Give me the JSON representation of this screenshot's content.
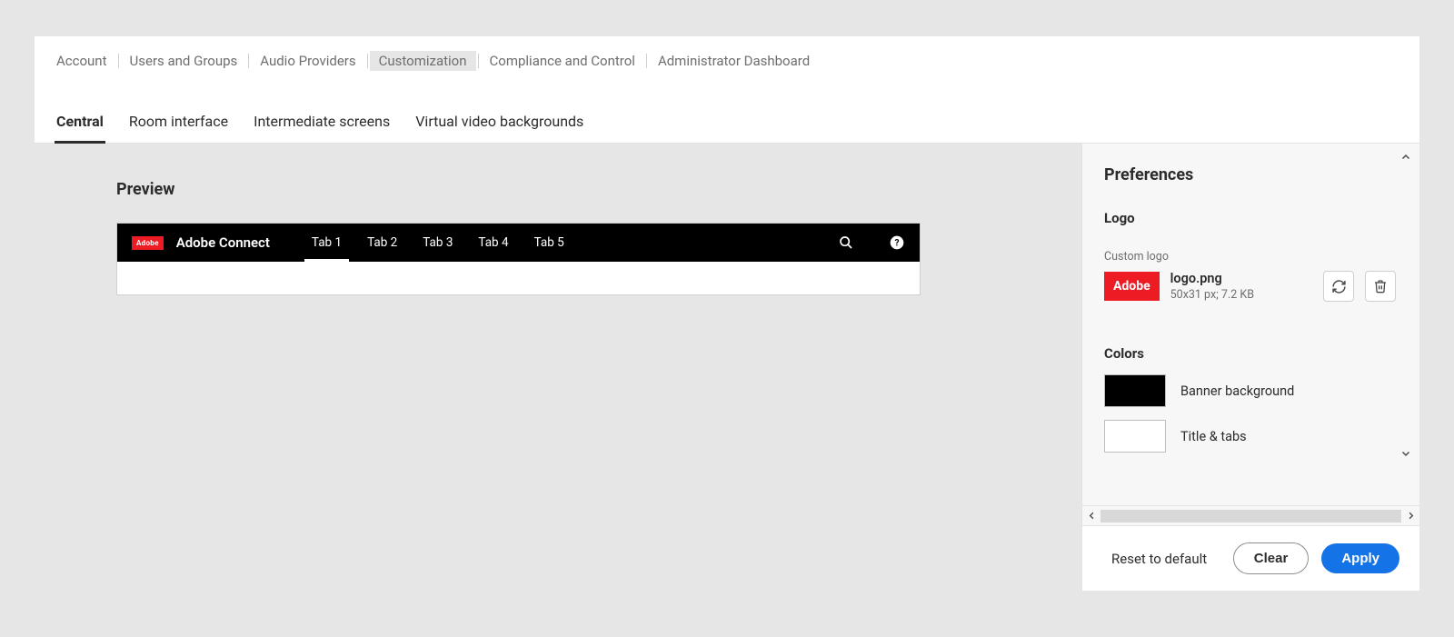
{
  "top_nav": {
    "items": [
      {
        "label": "Account",
        "active": false
      },
      {
        "label": "Users and Groups",
        "active": false
      },
      {
        "label": "Audio Providers",
        "active": false
      },
      {
        "label": "Customization",
        "active": true
      },
      {
        "label": "Compliance and Control",
        "active": false
      },
      {
        "label": "Administrator Dashboard",
        "active": false
      }
    ]
  },
  "sub_tabs": {
    "items": [
      {
        "label": "Central",
        "active": true
      },
      {
        "label": "Room interface",
        "active": false
      },
      {
        "label": "Intermediate screens",
        "active": false
      },
      {
        "label": "Virtual video backgrounds",
        "active": false
      }
    ]
  },
  "preview": {
    "title": "Preview",
    "logo_text": "Adobe",
    "app_name": "Adobe Connect",
    "tabs": [
      {
        "label": "Tab 1",
        "active": true
      },
      {
        "label": "Tab 2",
        "active": false
      },
      {
        "label": "Tab 3",
        "active": false
      },
      {
        "label": "Tab 4",
        "active": false
      },
      {
        "label": "Tab 5",
        "active": false
      }
    ]
  },
  "prefs": {
    "title": "Preferences",
    "logo_section_label": "Logo",
    "custom_logo_label": "Custom logo",
    "logo_chip_text": "Adobe",
    "logo_filename": "logo.png",
    "logo_dims": "50x31 px; 7.2 KB",
    "colors_section_label": "Colors",
    "color_rows": [
      {
        "label": "Banner background",
        "hex": "#000000"
      },
      {
        "label": "Title & tabs",
        "hex": "#ffffff"
      }
    ],
    "reset_label": "Reset to default",
    "clear_label": "Clear",
    "apply_label": "Apply"
  }
}
